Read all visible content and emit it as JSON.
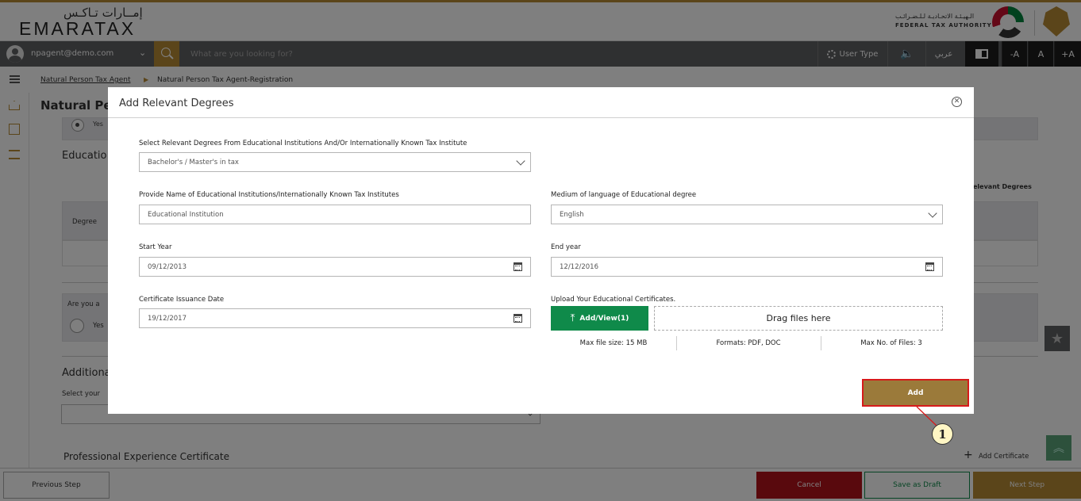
{
  "header": {
    "logo_ar": "إمــارات تـاكـس",
    "logo_en": "EMARATAX",
    "authority_ar": "الـهيـئـة الاتحـاديـة لـلـضـرائـب",
    "authority_en": "FEDERAL TAX AUTHORITY"
  },
  "toolbar": {
    "user_email": "npagent@demo.com",
    "user_chevron": "⌄",
    "search_placeholder": "What are you looking for?",
    "user_type": "User Type",
    "speaker_icon": "🔈",
    "arabic": "عربي",
    "font_decrease": "-A",
    "font_normal": "A",
    "font_increase": "+A"
  },
  "breadcrumb": {
    "item1": "Natural Person Tax Agent",
    "separator": "▶",
    "item2": "Natural Person Tax Agent-Registration"
  },
  "background": {
    "page_title": "Natural Pers",
    "radio_yes": "Yes",
    "education_heading": "Educatio",
    "relevant_degrees_link": "elevant Degrees",
    "degree_col": "Degree",
    "are_you": "Are you a",
    "yes2": "Yes",
    "additional_heading": "Additiona",
    "select_your": "Select your",
    "professional_heading": "Professional Experience Certificate",
    "add_certificate": "Add Certificate",
    "add_certificate_icon": "+"
  },
  "modal": {
    "title": "Add Relevant Degrees",
    "close_icon": "✕",
    "degree_label": "Select Relevant Degrees From Educational Institutions And/Or Internationally Known Tax Institute",
    "degree_value": "Bachelor's / Master's in tax",
    "institution_label": "Provide Name of Educational Institutions/Internationally Known Tax Institutes",
    "institution_placeholder": "Educational Institution",
    "language_label": "Medium of language of Educational degree",
    "language_value": "English",
    "start_label": "Start Year",
    "start_value": "09/12/2013",
    "end_label": "End year",
    "end_value": "12/12/2016",
    "issuance_label": "Certificate Issuance Date",
    "issuance_value": "19/12/2017",
    "upload_label": "Upload Your Educational Certificates.",
    "upload_icon": "⤒",
    "upload_button": "Add/View(1)",
    "drop_zone": "Drag files here",
    "max_size": "Max file size: 15 MB",
    "formats": "Formats: PDF, DOC",
    "max_files": "Max No. of Files: 3",
    "add_button": "Add"
  },
  "callout": {
    "number": "1"
  },
  "footer": {
    "previous": "Previous Step",
    "cancel": "Cancel",
    "save_draft": "Save as Draft",
    "next": "Next Step"
  },
  "floating": {
    "star_icon": "★",
    "top_icon": "︽"
  },
  "colors": {
    "gold": "#b68a35",
    "toolbar": "#5f6063",
    "green": "#0f8a4a",
    "cancel_red": "#b3121b",
    "callout_red": "#d71a1a"
  }
}
